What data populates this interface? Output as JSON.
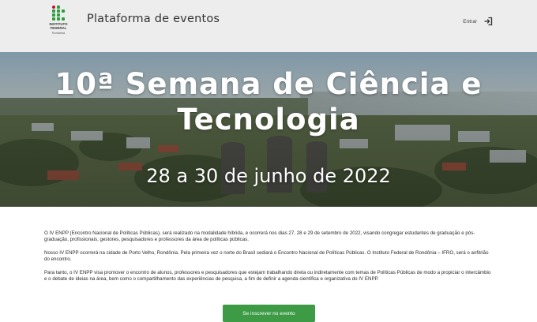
{
  "header": {
    "logo_lines": [
      "INSTITUTO",
      "FEDERAL"
    ],
    "logo_sub": "Rondônia",
    "title": "Plataforma de eventos",
    "login_label": "Entrar",
    "login_icon": "sign-in-icon",
    "brand_color": "#2e9e41"
  },
  "hero": {
    "title_line1": "10ª Semana de Ciência e",
    "title_line2": "Tecnologia",
    "dates": "28 a 30 de junho de 2022"
  },
  "content": {
    "paragraphs": [
      "O IV ENPP (Encontro Nacional de Políticas Públicas), será realizado na modalidade híbrida, e ocorrerá nos dias 27, 28 e 29 de setembro de 2022, visando congregar estudantes de graduação e pós-graduação, profissionais, gestores, pesquisadores e professores da área de políticas públicas.",
      "Nosso IV ENPP ocorrerá na cidade de Porto Velho, Rondônia. Pela primeira vez o norte do Brasil sediará o Encontro Nacional de Políticas Públicas. O Instituto Federal de Rondônia – IFRO, será o anfitrião do encontro.",
      "Para tanto, o IV ENPP visa promover o encontro de alunos, professores e pesquisadores que estejam trabalhando direta ou indiretamente com temas de Políticas Públicas de modo a propiciar o intercâmbio e o debate de ideias na área, bem como o compartilhamento das experiências de pesquisa, a fim de definir a agenda científica e organizativa do IV ENPP."
    ]
  },
  "cta": {
    "label": "Se inscrever no evento",
    "color": "#3d9a45"
  }
}
